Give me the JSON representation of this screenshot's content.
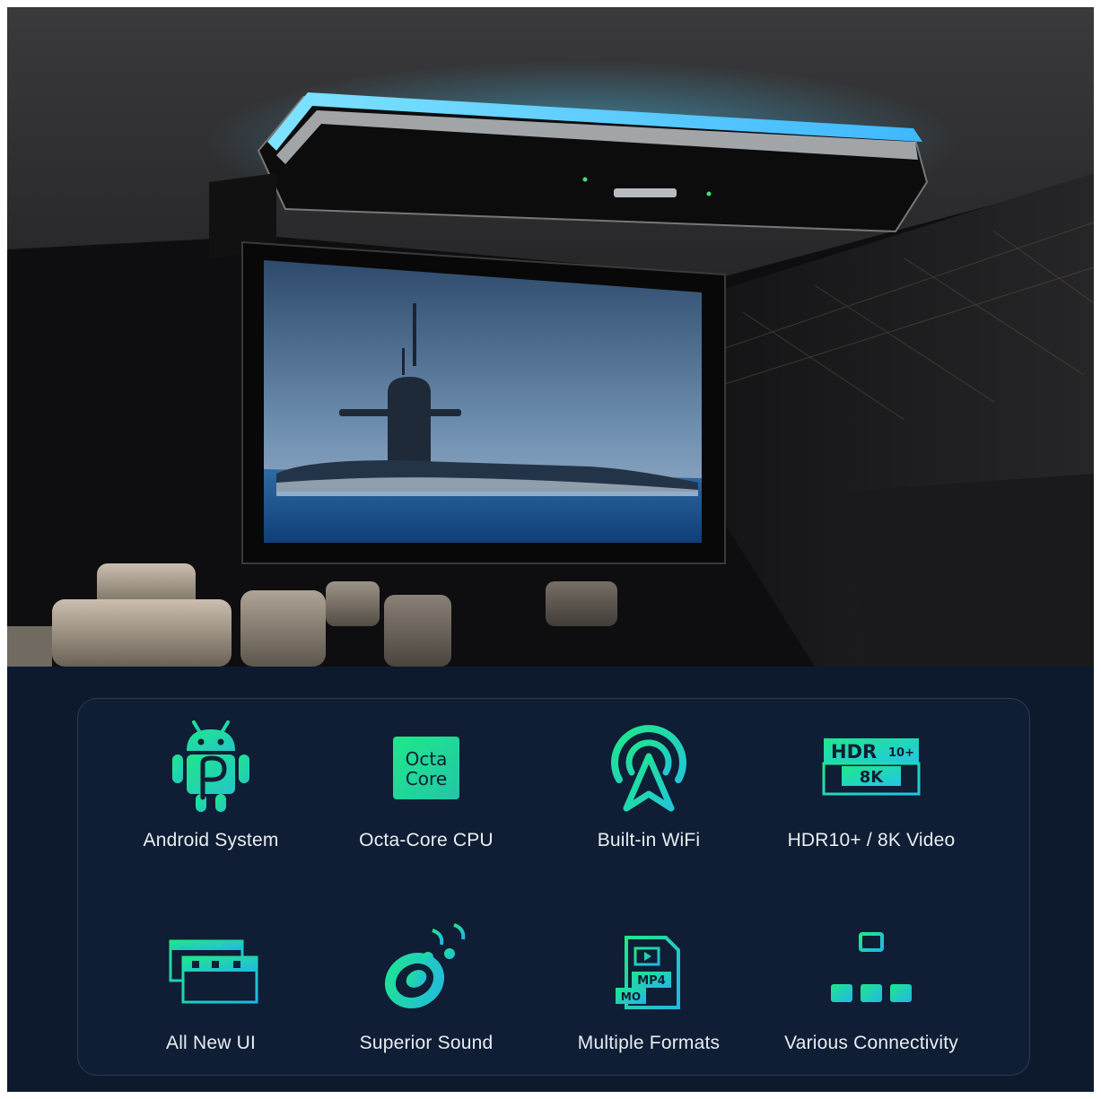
{
  "hero": {
    "scene": "car ceiling flip-down monitor showing a submarine",
    "accent_glow": "#3fd6ff"
  },
  "colors": {
    "panel_bg": "#0d1a2e",
    "card_border": "#2a3b55",
    "icon_gradient_start": "#1ee88a",
    "icon_gradient_end": "#23b6e6",
    "label_text": "#e9edf3"
  },
  "features": [
    {
      "label": "Android System",
      "icon": "android-p-icon"
    },
    {
      "label": "Octa-Core CPU",
      "icon": "cpu-chip-icon",
      "icon_text": [
        "Octa",
        "Core"
      ]
    },
    {
      "label": "Built-in WiFi",
      "icon": "wifi-antenna-icon"
    },
    {
      "label": "HDR10+ / 8K Video",
      "icon": "hdr-8k-icon",
      "icon_text": [
        "HDR",
        "10+",
        "8K"
      ]
    },
    {
      "label": "All New UI",
      "icon": "ui-screens-icon"
    },
    {
      "label": "Superior Sound",
      "icon": "speaker-music-icon"
    },
    {
      "label": "Multiple Formats",
      "icon": "file-formats-icon",
      "icon_text": [
        "MP4",
        "MO"
      ]
    },
    {
      "label": "Various Connectivity",
      "icon": "network-tree-icon"
    }
  ]
}
